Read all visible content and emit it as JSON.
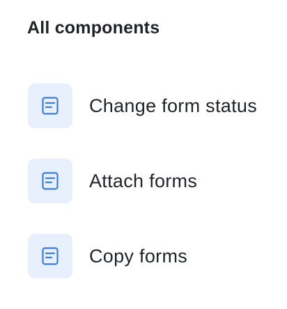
{
  "header": {
    "title": "All components"
  },
  "components": [
    {
      "label": "Change form status",
      "icon": "form-icon"
    },
    {
      "label": "Attach forms",
      "icon": "form-icon"
    },
    {
      "label": "Copy forms",
      "icon": "form-icon"
    }
  ],
  "colors": {
    "icon_tile_bg": "#e8f0fd",
    "icon_stroke": "#3b7ddd"
  }
}
